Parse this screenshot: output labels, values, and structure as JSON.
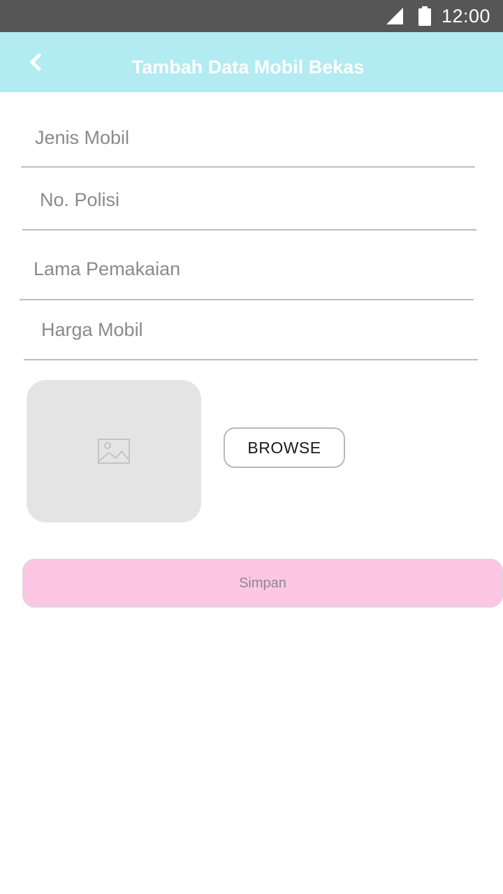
{
  "status_bar": {
    "time": "12:00",
    "icons": [
      "signal-icon",
      "battery-icon"
    ],
    "background": "#565656"
  },
  "app_bar": {
    "title": "Tambah Data Mobil Bekas",
    "back_icon": "chevron-left-icon",
    "background": "#b2ebf2"
  },
  "form": {
    "fields": [
      {
        "name": "jenis-mobil",
        "placeholder": "Jenis Mobil",
        "value": ""
      },
      {
        "name": "no-polisi",
        "placeholder": "No. Polisi",
        "value": ""
      },
      {
        "name": "lama-pemakaian",
        "placeholder": "Lama Pemakaian",
        "value": ""
      },
      {
        "name": "harga-mobil",
        "placeholder": "Harga Mobil",
        "value": ""
      }
    ],
    "image_placeholder_icon": "image-icon",
    "browse_label": "BROWSE",
    "save_label": "Simpan",
    "save_color": "#fdc6e4"
  }
}
